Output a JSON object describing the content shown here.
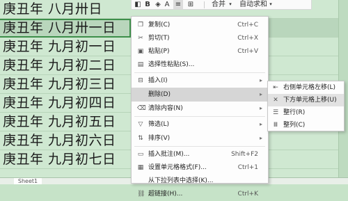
{
  "sheet": {
    "rows": [
      "庚丑年 八月卅日",
      "庚丑年 八月卅一日",
      "庚丑年 九月初一日",
      "庚丑年 九月初二日",
      "庚丑年 九月初三日",
      "庚丑年 九月初四日",
      "庚丑年 九月初五日",
      "庚丑年 九月初六日",
      "庚丑年 九月初七日"
    ],
    "tab_label": "Sheet1"
  },
  "toolbar": {
    "bold": "B",
    "merge": "合并",
    "autosum": "自动求和"
  },
  "menu": {
    "copy": {
      "label": "复制(C)",
      "shortcut": "Ctrl+C"
    },
    "cut": {
      "label": "剪切(T)",
      "shortcut": "Ctrl+X"
    },
    "paste": {
      "label": "粘贴(P)",
      "shortcut": "Ctrl+V"
    },
    "paste_special": {
      "label": "选择性粘贴(S)..."
    },
    "insert": {
      "label": "插入(I)"
    },
    "delete": {
      "label": "删除(D)"
    },
    "clear": {
      "label": "清除内容(N)"
    },
    "filter": {
      "label": "筛选(L)"
    },
    "sort": {
      "label": "排序(V)"
    },
    "insert_comment": {
      "label": "插入批注(M)...",
      "shortcut": "Shift+F2"
    },
    "format_cells": {
      "label": "设置单元格格式(F)...",
      "shortcut": "Ctrl+1"
    },
    "pick_list": {
      "label": "从下拉列表中选择(K)..."
    },
    "hyperlink": {
      "label": "超链接(H)...",
      "shortcut": "Ctrl+K"
    }
  },
  "submenu": {
    "shift_left": "右侧单元格左移(L)",
    "shift_up": "下方单元格上移(U)",
    "entire_row": "整行(R)",
    "entire_col": "整列(C)"
  },
  "colors": {
    "sheet_bg": "#cfe8d1",
    "selection_border": "#3d8f4a",
    "menu_highlight": "#d6d6d6"
  }
}
